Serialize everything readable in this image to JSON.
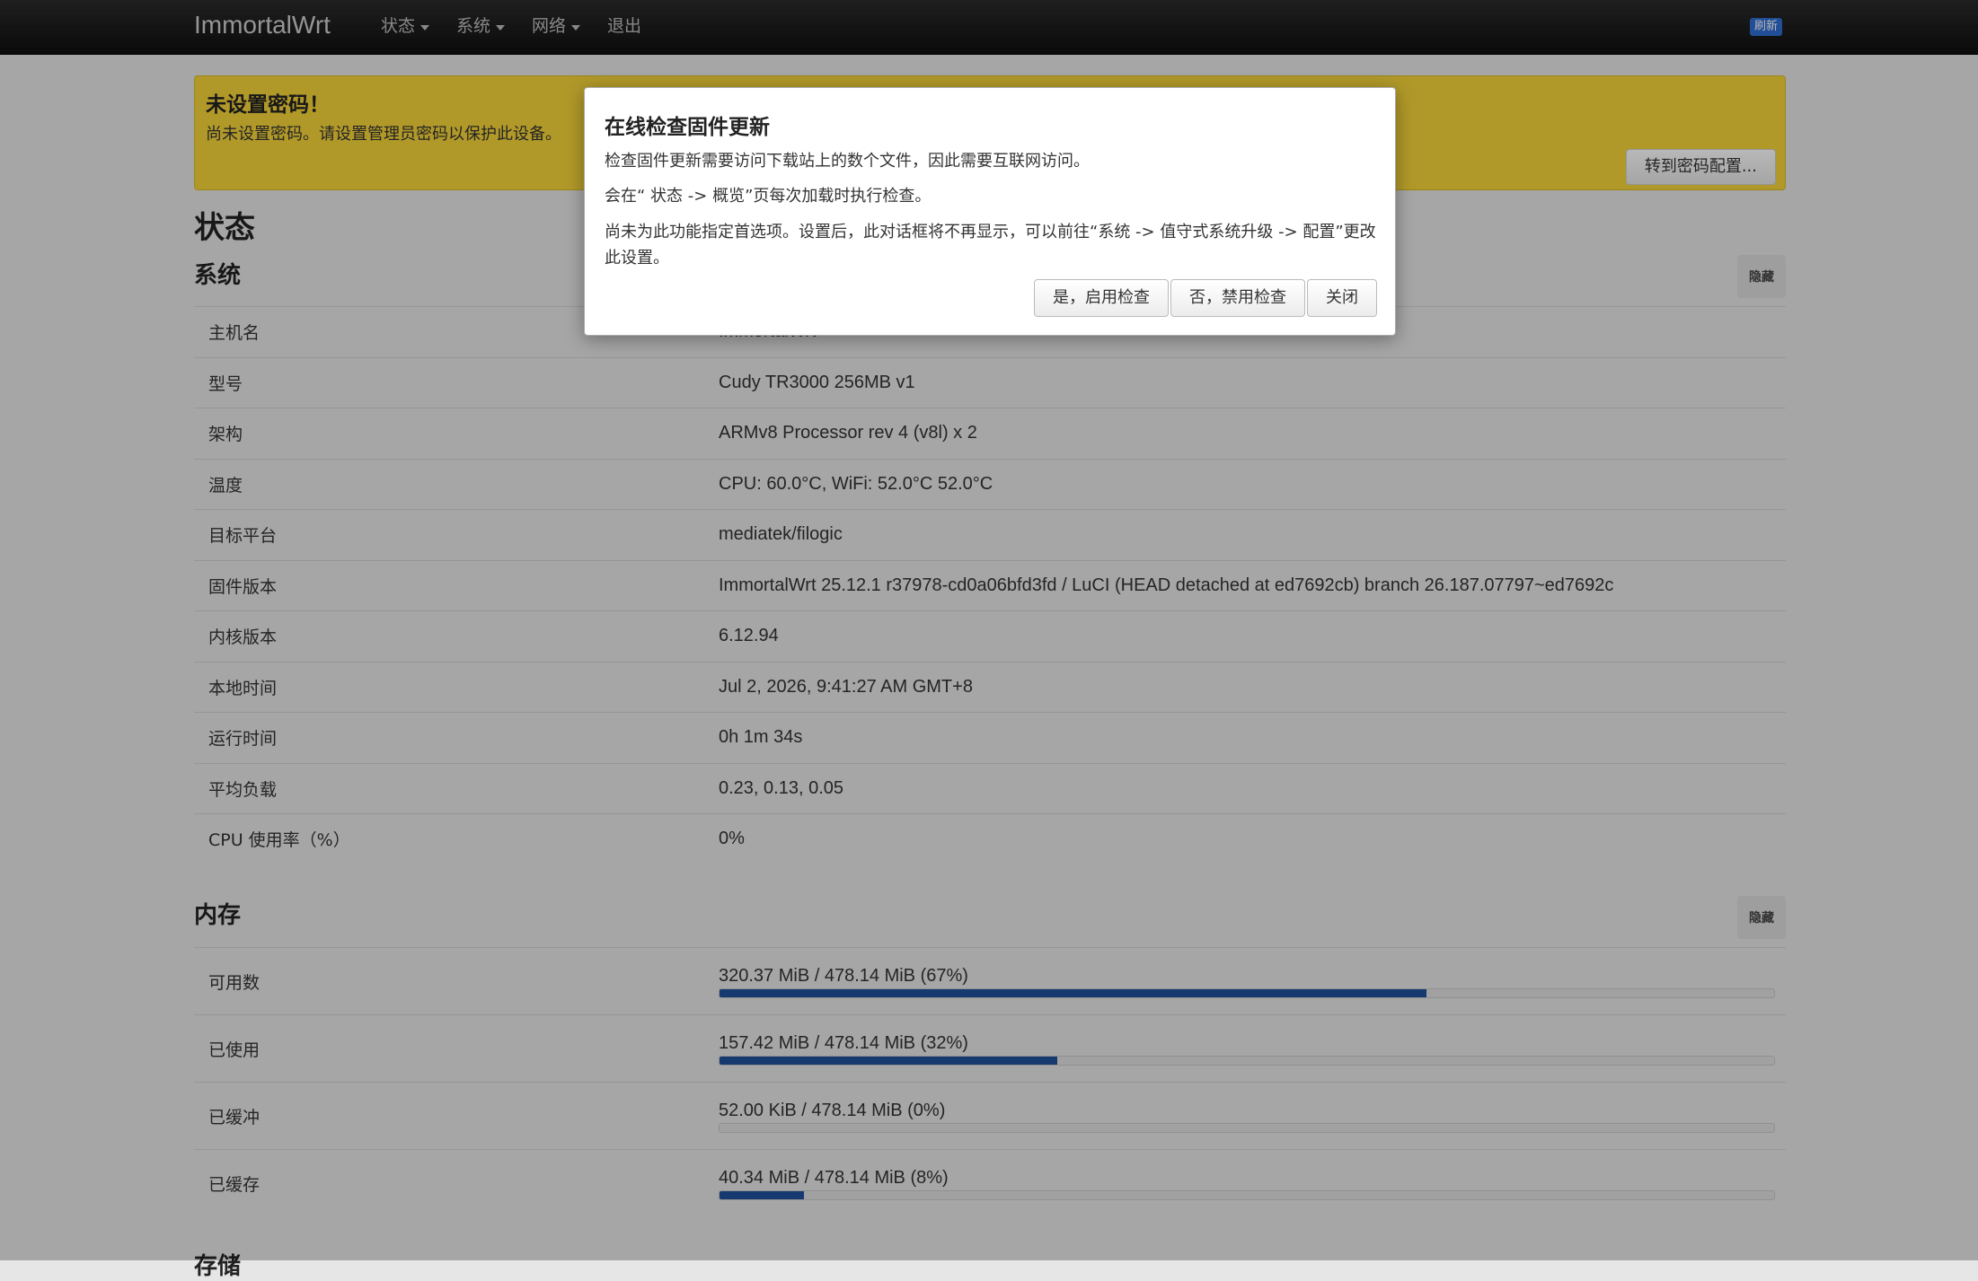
{
  "navbar": {
    "brand": "ImmortalWrt",
    "menu": [
      "状态",
      "系统",
      "网络",
      "退出"
    ],
    "refresh": "刷新"
  },
  "alert": {
    "title": "未设置密码！",
    "text": "尚未设置密码。请设置管理员密码以保护此设备。",
    "button": "转到密码配置..."
  },
  "page": {
    "title": "状态"
  },
  "system": {
    "title": "系统",
    "hide": "隐藏",
    "rows": [
      {
        "key": "主机名",
        "value": "ImmortalWrt"
      },
      {
        "key": "型号",
        "value": "Cudy TR3000 256MB v1"
      },
      {
        "key": "架构",
        "value": "ARMv8 Processor rev 4 (v8l) x 2"
      },
      {
        "key": "温度",
        "value": "CPU: 60.0°C, WiFi: 52.0°C 52.0°C"
      },
      {
        "key": "目标平台",
        "value": "mediatek/filogic"
      },
      {
        "key": "固件版本",
        "value": "ImmortalWrt 25.12.1 r37978-cd0a06bfd3fd / LuCI (HEAD detached at ed7692cb) branch 26.187.07797~ed7692c"
      },
      {
        "key": "内核版本",
        "value": "6.12.94"
      },
      {
        "key": "本地时间",
        "value": "Jul 2, 2026, 9:41:27 AM GMT+8"
      },
      {
        "key": "运行时间",
        "value": "0h 1m 34s"
      },
      {
        "key": "平均负载",
        "value": "0.23, 0.13, 0.05"
      },
      {
        "key": "CPU 使用率（%）",
        "value": "0%"
      }
    ]
  },
  "memory": {
    "title": "内存",
    "hide": "隐藏",
    "rows": [
      {
        "key": "可用数",
        "value": "320.37 MiB / 478.14 MiB (67%)",
        "percent": 67
      },
      {
        "key": "已使用",
        "value": "157.42 MiB / 478.14 MiB (32%)",
        "percent": 32
      },
      {
        "key": "已缓冲",
        "value": "52.00 KiB / 478.14 MiB (0%)",
        "percent": 0
      },
      {
        "key": "已缓存",
        "value": "40.34 MiB / 478.14 MiB (8%)",
        "percent": 8
      }
    ]
  },
  "storage": {
    "title": "存储"
  },
  "modal": {
    "title": "在线检查固件更新",
    "p1": "检查固件更新需要访问下载站上的数个文件，因此需要互联网访问。",
    "p2": "会在“ 状态 -> 概览”页每次加载时执行检查。",
    "p3": "尚未为此功能指定首选项。设置后，此对话框将不再显示，可以前往“系统 -> 值守式系统升级 -> 配置”更改此设置。",
    "btn_yes": "是，启用检查",
    "btn_no": "否，禁用检查",
    "btn_close": "关闭"
  }
}
